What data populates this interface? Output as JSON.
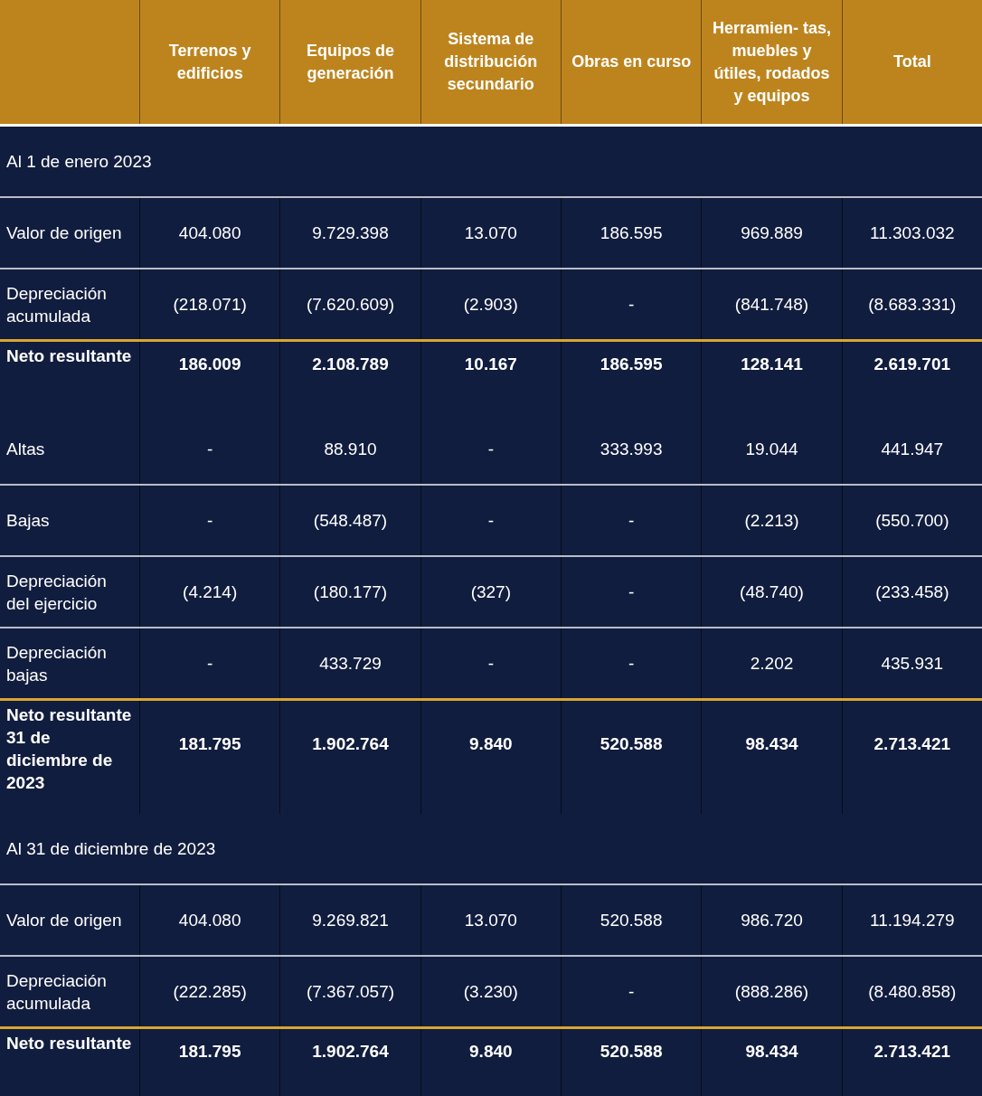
{
  "table": {
    "columns": [
      "",
      "Terrenos y edificios",
      "Equipos de generación",
      "Sistema de distribución secundario",
      "Obras en curso",
      "Herramien- tas, muebles y útiles, rodados y equipos",
      "Total"
    ],
    "rows": [
      {
        "kind": "section",
        "label": "Al 1 de enero 2023"
      },
      {
        "kind": "data",
        "label": "Valor de origen",
        "values": [
          "404.080",
          "9.729.398",
          "13.070",
          "186.595",
          "969.889",
          "11.303.032"
        ]
      },
      {
        "kind": "data",
        "label": "Depreciación acumulada",
        "values": [
          "(218.071)",
          "(7.620.609)",
          "(2.903)",
          "-",
          "(841.748)",
          "(8.683.331)"
        ]
      },
      {
        "kind": "total",
        "label": "Neto resultante",
        "values": [
          "186.009",
          "2.108.789",
          "10.167",
          "186.595",
          "128.141",
          "2.619.701"
        ]
      },
      {
        "kind": "data",
        "label": "Altas",
        "values": [
          "-",
          "88.910",
          "-",
          "333.993",
          "19.044",
          "441.947"
        ]
      },
      {
        "kind": "data",
        "label": "Bajas",
        "values": [
          "-",
          "(548.487)",
          "-",
          "-",
          "(2.213)",
          "(550.700)"
        ]
      },
      {
        "kind": "data",
        "label": "Depreciación del ejercicio",
        "values": [
          "(4.214)",
          "(180.177)",
          "(327)",
          "-",
          "(48.740)",
          "(233.458)"
        ]
      },
      {
        "kind": "data",
        "label": "Depreciación bajas",
        "values": [
          "-",
          "433.729",
          "-",
          "-",
          "2.202",
          "435.931"
        ]
      },
      {
        "kind": "total",
        "label": "Neto resultante 31 de diciembre de 2023",
        "values": [
          "181.795",
          "1.902.764",
          "9.840",
          "520.588",
          "98.434",
          "2.713.421"
        ]
      },
      {
        "kind": "section",
        "label": "Al 31 de diciembre de 2023"
      },
      {
        "kind": "data",
        "label": "Valor de origen",
        "values": [
          "404.080",
          "9.269.821",
          "13.070",
          "520.588",
          "986.720",
          "11.194.279"
        ]
      },
      {
        "kind": "data",
        "label": "Depreciación acumulada",
        "values": [
          "(222.285)",
          "(7.367.057)",
          "(3.230)",
          "-",
          "(888.286)",
          "(8.480.858)"
        ]
      },
      {
        "kind": "total",
        "label": "Neto resultante",
        "values": [
          "181.795",
          "1.902.764",
          "9.840",
          "520.588",
          "98.434",
          "2.713.421"
        ]
      }
    ]
  }
}
